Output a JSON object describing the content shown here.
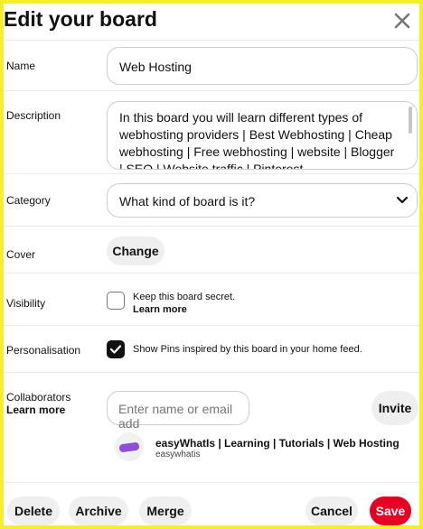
{
  "dialog": {
    "title": "Edit your board"
  },
  "name": {
    "label": "Name",
    "value": "Web Hosting"
  },
  "description": {
    "label": "Description",
    "value": "In this board you will learn different types of webhosting providers | Best Webhosting | Cheap webhosting | Free webhosting | website | Blogger | SEO | Website traffic | Pinterest"
  },
  "category": {
    "label": "Category",
    "placeholder": "What kind of board is it?"
  },
  "cover": {
    "label": "Cover",
    "button": "Change"
  },
  "visibility": {
    "label": "Visibility",
    "text": "Keep this board secret.",
    "link": "Learn more",
    "checked": false
  },
  "personalisation": {
    "label": "Personalisation",
    "text": "Show Pins inspired by this board in your home feed.",
    "checked": true
  },
  "collaborators": {
    "label": "Collaborators",
    "link": "Learn more",
    "input_placeholder": "Enter name or email add",
    "invite_button": "Invite",
    "owner": {
      "name": "easyWhatIs | Learning | Tutorials | Web Hosting",
      "username": "easywhatis"
    }
  },
  "footer": {
    "delete": "Delete",
    "archive": "Archive",
    "merge": "Merge",
    "cancel": "Cancel",
    "save": "Save"
  },
  "colors": {
    "save": "#e60023",
    "background": "#f5ef2a",
    "pill": "#efefef",
    "avatar": "#8e4fd6"
  }
}
